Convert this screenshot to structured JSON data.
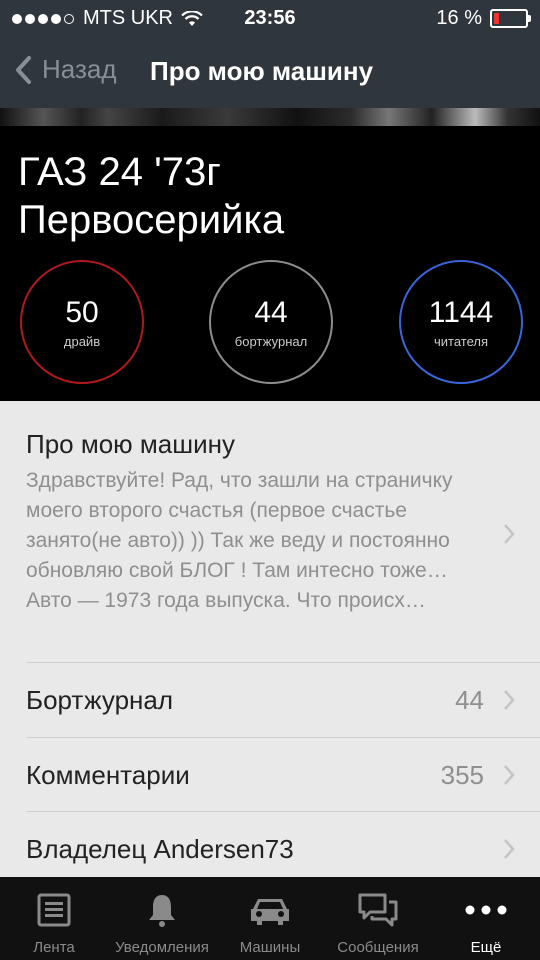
{
  "status_bar": {
    "carrier": "MTS UKR",
    "time": "23:56",
    "battery": "16 %"
  },
  "nav": {
    "back_label": "Назад",
    "title": "Про мою машину"
  },
  "hero": {
    "title_line1": "ГАЗ 24 '73г",
    "title_line2": "Первосерийка",
    "stats": [
      {
        "value": "50",
        "label": "драйв"
      },
      {
        "value": "44",
        "label": "бортжурнал"
      },
      {
        "value": "1144",
        "label": "читателя"
      }
    ]
  },
  "about": {
    "title": "Про мою машину",
    "text": "Здравствуйте! Рад, что зашли на страничку моего второго счастья (первое счастье занято(не авто)) )) Так же веду и постоянно обновляю свой БЛОГ ! Там интесно тоже… Авто — 1973 года выпуска. Что происх…"
  },
  "rows": [
    {
      "label": "Бортжурнал",
      "count": "44"
    },
    {
      "label": "Комментарии",
      "count": "355"
    },
    {
      "label": "Владелец Andersen73",
      "count": ""
    }
  ],
  "tabs": [
    {
      "label": "Лента",
      "icon": "list-icon"
    },
    {
      "label": "Уведомления",
      "icon": "bell-icon"
    },
    {
      "label": "Машины",
      "icon": "car-icon"
    },
    {
      "label": "Сообщения",
      "icon": "chat-icon"
    },
    {
      "label": "Ещё",
      "icon": "more-icon"
    }
  ],
  "colors": {
    "drive_ring": "#b0191c",
    "journal_ring": "#8c8c8c",
    "readers_ring": "#3a64d8",
    "battery_low": "#e33333"
  }
}
